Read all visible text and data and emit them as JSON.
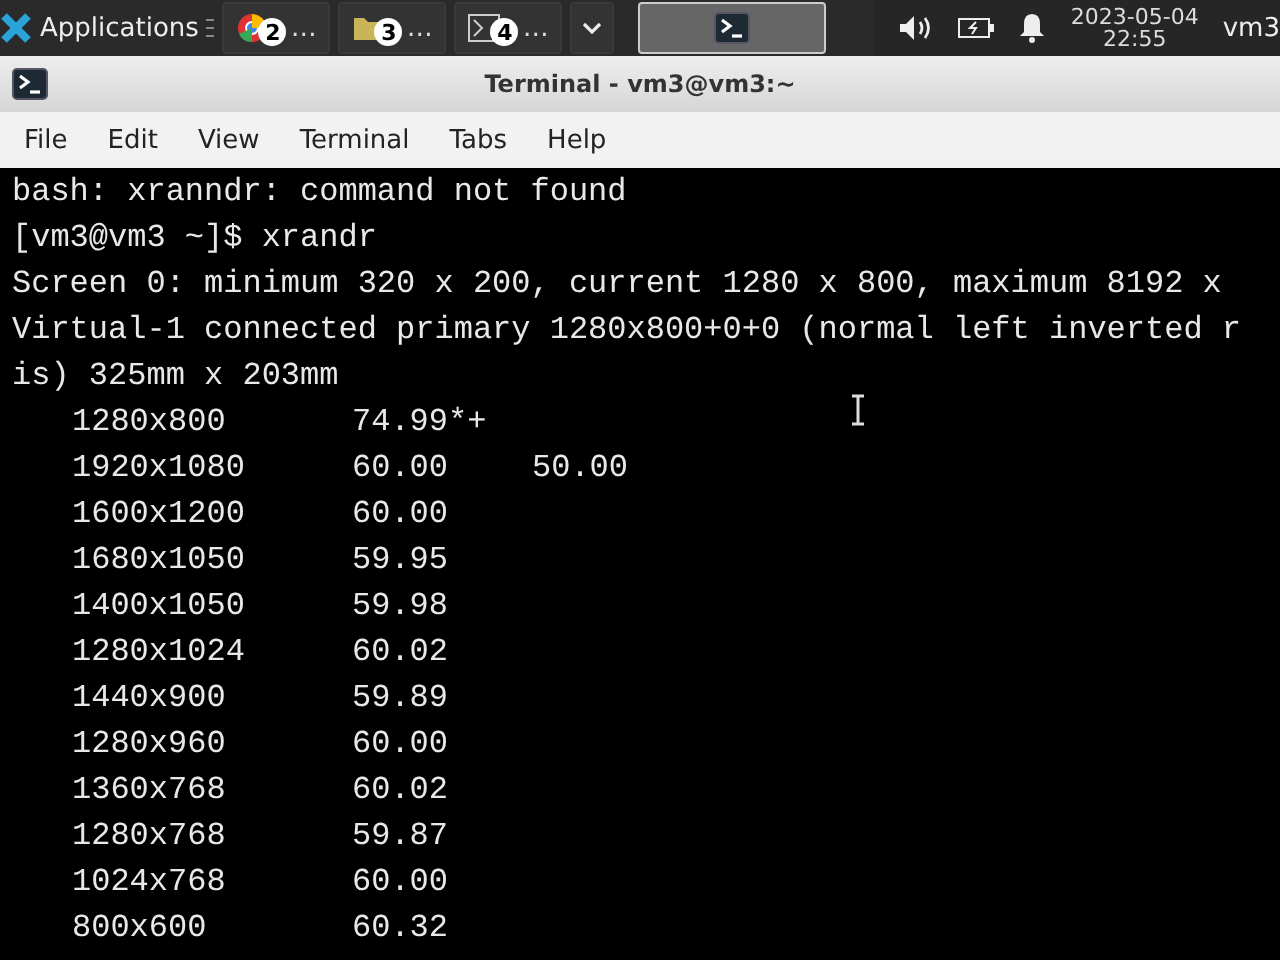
{
  "panel": {
    "menu_label": "Applications",
    "tasks": [
      {
        "kind": "browser",
        "badge": "2",
        "label": "…",
        "selected": false
      },
      {
        "kind": "files",
        "badge": "3",
        "label": "…",
        "selected": false
      },
      {
        "kind": "window",
        "badge": "4",
        "label": "…",
        "selected": false
      }
    ],
    "active_task": {
      "selected": true
    },
    "date": "2023-05-04",
    "time": "22:55",
    "user": "vm3"
  },
  "window": {
    "title": "Terminal - vm3@vm3:~"
  },
  "menu": [
    "File",
    "Edit",
    "View",
    "Terminal",
    "Tabs",
    "Help"
  ],
  "terminal": {
    "lines": [
      "bash: xranndr: command not found",
      "[vm3@vm3 ~]$ xrandr",
      "Screen 0: minimum 320 x 200, current 1280 x 800, maximum 8192 x",
      "Virtual-1 connected primary 1280x800+0+0 (normal left inverted r",
      "is) 325mm x 203mm"
    ],
    "modes": [
      {
        "resolution": "1280x800",
        "rates": [
          "74.99*+"
        ]
      },
      {
        "resolution": "1920x1080",
        "rates": [
          "60.00",
          "50.00"
        ]
      },
      {
        "resolution": "1600x1200",
        "rates": [
          "60.00"
        ]
      },
      {
        "resolution": "1680x1050",
        "rates": [
          "59.95"
        ]
      },
      {
        "resolution": "1400x1050",
        "rates": [
          "59.98"
        ]
      },
      {
        "resolution": "1280x1024",
        "rates": [
          "60.02"
        ]
      },
      {
        "resolution": "1440x900",
        "rates": [
          "59.89"
        ]
      },
      {
        "resolution": "1280x960",
        "rates": [
          "60.00"
        ]
      },
      {
        "resolution": "1360x768",
        "rates": [
          "60.02"
        ]
      },
      {
        "resolution": "1280x768",
        "rates": [
          "59.87"
        ]
      },
      {
        "resolution": "1024x768",
        "rates": [
          "60.00"
        ]
      },
      {
        "resolution": "800x600",
        "rates": [
          "60.32"
        ]
      }
    ]
  }
}
